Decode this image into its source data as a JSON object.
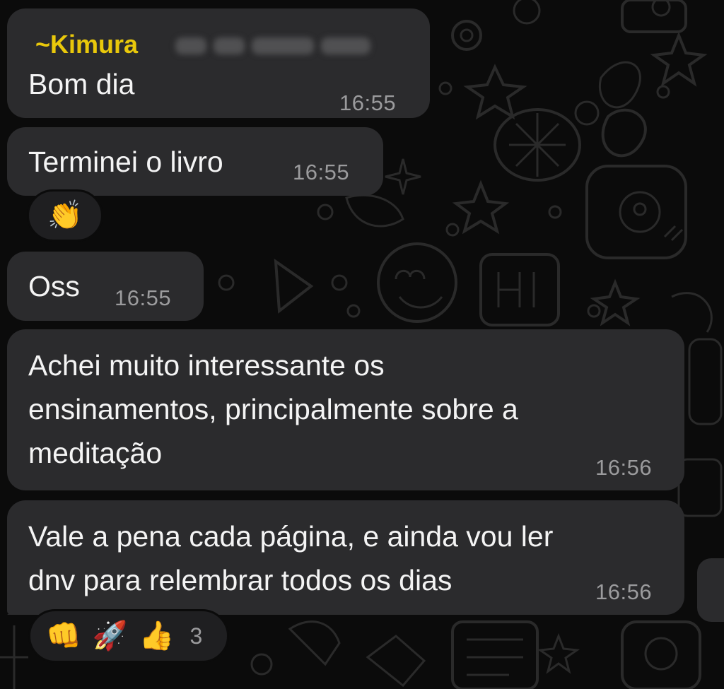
{
  "chat": {
    "sender": {
      "prefix": "~",
      "name": "Kimura"
    },
    "messages": [
      {
        "text": "Bom dia",
        "time": "16:55"
      },
      {
        "text": "Terminei o livro",
        "time": "16:55"
      },
      {
        "text": "Oss",
        "time": "16:55"
      },
      {
        "text": "Achei muito interessante os\nensinamentos, principalmente sobre a\nmeditação",
        "time": "16:56"
      },
      {
        "text": "Vale a pena cada página, e ainda vou ler\ndnv para relembrar todos os dias",
        "time": "16:56"
      }
    ],
    "reactions": {
      "msg2": {
        "emojis": [
          "👏"
        ]
      },
      "msg5": {
        "emojis": [
          "👊",
          "🚀",
          "👍"
        ],
        "count": "3"
      }
    }
  },
  "colors": {
    "background": "#0b0b0b",
    "bubble": "#2b2b2d",
    "sender_name": "#e9c80b",
    "timestamp": "#9b9b9d"
  }
}
